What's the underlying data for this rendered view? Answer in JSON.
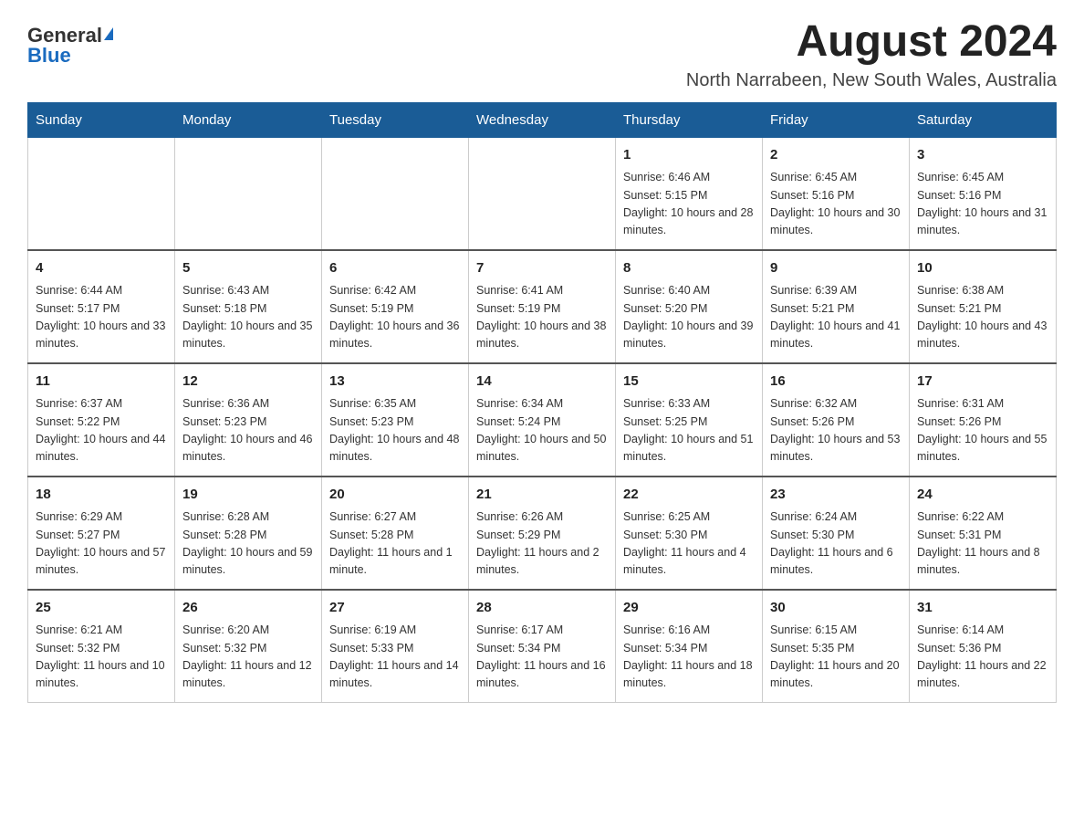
{
  "logo": {
    "general": "General",
    "blue": "Blue"
  },
  "title": "August 2024",
  "location": "North Narrabeen, New South Wales, Australia",
  "headers": [
    "Sunday",
    "Monday",
    "Tuesday",
    "Wednesday",
    "Thursday",
    "Friday",
    "Saturday"
  ],
  "weeks": [
    [
      {
        "day": "",
        "info": ""
      },
      {
        "day": "",
        "info": ""
      },
      {
        "day": "",
        "info": ""
      },
      {
        "day": "",
        "info": ""
      },
      {
        "day": "1",
        "info": "Sunrise: 6:46 AM\nSunset: 5:15 PM\nDaylight: 10 hours and 28 minutes."
      },
      {
        "day": "2",
        "info": "Sunrise: 6:45 AM\nSunset: 5:16 PM\nDaylight: 10 hours and 30 minutes."
      },
      {
        "day": "3",
        "info": "Sunrise: 6:45 AM\nSunset: 5:16 PM\nDaylight: 10 hours and 31 minutes."
      }
    ],
    [
      {
        "day": "4",
        "info": "Sunrise: 6:44 AM\nSunset: 5:17 PM\nDaylight: 10 hours and 33 minutes."
      },
      {
        "day": "5",
        "info": "Sunrise: 6:43 AM\nSunset: 5:18 PM\nDaylight: 10 hours and 35 minutes."
      },
      {
        "day": "6",
        "info": "Sunrise: 6:42 AM\nSunset: 5:19 PM\nDaylight: 10 hours and 36 minutes."
      },
      {
        "day": "7",
        "info": "Sunrise: 6:41 AM\nSunset: 5:19 PM\nDaylight: 10 hours and 38 minutes."
      },
      {
        "day": "8",
        "info": "Sunrise: 6:40 AM\nSunset: 5:20 PM\nDaylight: 10 hours and 39 minutes."
      },
      {
        "day": "9",
        "info": "Sunrise: 6:39 AM\nSunset: 5:21 PM\nDaylight: 10 hours and 41 minutes."
      },
      {
        "day": "10",
        "info": "Sunrise: 6:38 AM\nSunset: 5:21 PM\nDaylight: 10 hours and 43 minutes."
      }
    ],
    [
      {
        "day": "11",
        "info": "Sunrise: 6:37 AM\nSunset: 5:22 PM\nDaylight: 10 hours and 44 minutes."
      },
      {
        "day": "12",
        "info": "Sunrise: 6:36 AM\nSunset: 5:23 PM\nDaylight: 10 hours and 46 minutes."
      },
      {
        "day": "13",
        "info": "Sunrise: 6:35 AM\nSunset: 5:23 PM\nDaylight: 10 hours and 48 minutes."
      },
      {
        "day": "14",
        "info": "Sunrise: 6:34 AM\nSunset: 5:24 PM\nDaylight: 10 hours and 50 minutes."
      },
      {
        "day": "15",
        "info": "Sunrise: 6:33 AM\nSunset: 5:25 PM\nDaylight: 10 hours and 51 minutes."
      },
      {
        "day": "16",
        "info": "Sunrise: 6:32 AM\nSunset: 5:26 PM\nDaylight: 10 hours and 53 minutes."
      },
      {
        "day": "17",
        "info": "Sunrise: 6:31 AM\nSunset: 5:26 PM\nDaylight: 10 hours and 55 minutes."
      }
    ],
    [
      {
        "day": "18",
        "info": "Sunrise: 6:29 AM\nSunset: 5:27 PM\nDaylight: 10 hours and 57 minutes."
      },
      {
        "day": "19",
        "info": "Sunrise: 6:28 AM\nSunset: 5:28 PM\nDaylight: 10 hours and 59 minutes."
      },
      {
        "day": "20",
        "info": "Sunrise: 6:27 AM\nSunset: 5:28 PM\nDaylight: 11 hours and 1 minute."
      },
      {
        "day": "21",
        "info": "Sunrise: 6:26 AM\nSunset: 5:29 PM\nDaylight: 11 hours and 2 minutes."
      },
      {
        "day": "22",
        "info": "Sunrise: 6:25 AM\nSunset: 5:30 PM\nDaylight: 11 hours and 4 minutes."
      },
      {
        "day": "23",
        "info": "Sunrise: 6:24 AM\nSunset: 5:30 PM\nDaylight: 11 hours and 6 minutes."
      },
      {
        "day": "24",
        "info": "Sunrise: 6:22 AM\nSunset: 5:31 PM\nDaylight: 11 hours and 8 minutes."
      }
    ],
    [
      {
        "day": "25",
        "info": "Sunrise: 6:21 AM\nSunset: 5:32 PM\nDaylight: 11 hours and 10 minutes."
      },
      {
        "day": "26",
        "info": "Sunrise: 6:20 AM\nSunset: 5:32 PM\nDaylight: 11 hours and 12 minutes."
      },
      {
        "day": "27",
        "info": "Sunrise: 6:19 AM\nSunset: 5:33 PM\nDaylight: 11 hours and 14 minutes."
      },
      {
        "day": "28",
        "info": "Sunrise: 6:17 AM\nSunset: 5:34 PM\nDaylight: 11 hours and 16 minutes."
      },
      {
        "day": "29",
        "info": "Sunrise: 6:16 AM\nSunset: 5:34 PM\nDaylight: 11 hours and 18 minutes."
      },
      {
        "day": "30",
        "info": "Sunrise: 6:15 AM\nSunset: 5:35 PM\nDaylight: 11 hours and 20 minutes."
      },
      {
        "day": "31",
        "info": "Sunrise: 6:14 AM\nSunset: 5:36 PM\nDaylight: 11 hours and 22 minutes."
      }
    ]
  ]
}
